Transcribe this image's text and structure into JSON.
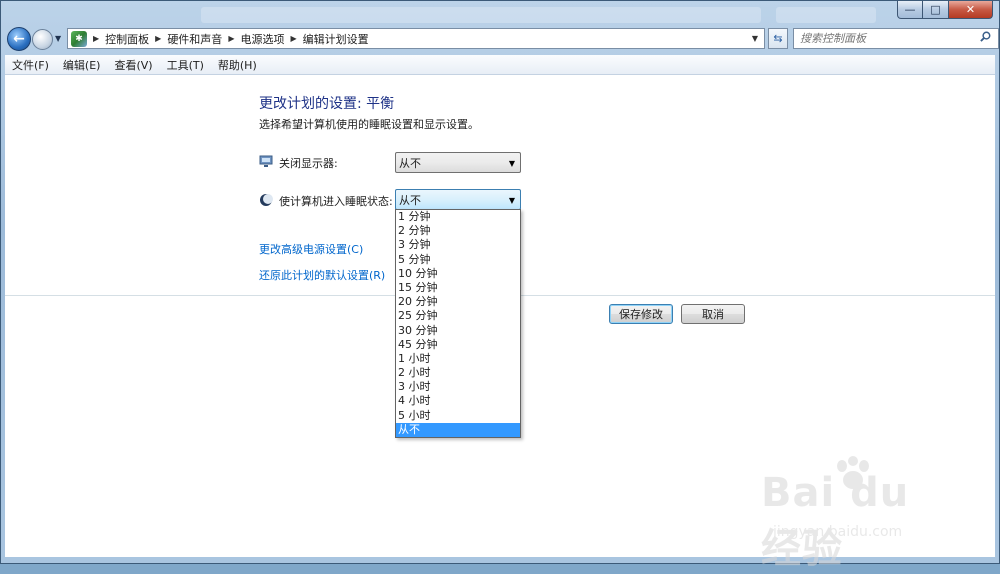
{
  "window": {
    "caption_buttons": {
      "minimize": "—",
      "maximize": "□",
      "close": "✕"
    }
  },
  "navbar": {
    "breadcrumbs": [
      "控制面板",
      "硬件和声音",
      "电源选项",
      "编辑计划设置"
    ],
    "search_placeholder": "搜索控制面板"
  },
  "menubar": {
    "items": [
      "文件(F)",
      "编辑(E)",
      "查看(V)",
      "工具(T)",
      "帮助(H)"
    ]
  },
  "main": {
    "title": "更改计划的设置: 平衡",
    "subtitle": "选择希望计算机使用的睡眠设置和显示设置。",
    "display_off": {
      "label": "关闭显示器:",
      "value": "从不"
    },
    "sleep": {
      "label": "使计算机进入睡眠状态:",
      "value": "从不"
    },
    "advanced_link": "更改高级电源设置(C)",
    "restore_link": "还原此计划的默认设置(R)",
    "save_button": "保存修改",
    "cancel_button": "取消"
  },
  "dropdown": {
    "options": [
      "1 分钟",
      "2 分钟",
      "3 分钟",
      "5 分钟",
      "10 分钟",
      "15 分钟",
      "20 分钟",
      "25 分钟",
      "30 分钟",
      "45 分钟",
      "1 小时",
      "2 小时",
      "3 小时",
      "4 小时",
      "5 小时",
      "从不"
    ],
    "selected_index": 15
  },
  "watermark": {
    "logo": "Bai du 经验",
    "url": "jingyan.baidu.com"
  },
  "colors": {
    "heading": "#1e3287",
    "link": "#0066cc",
    "selection": "#3399ff"
  }
}
